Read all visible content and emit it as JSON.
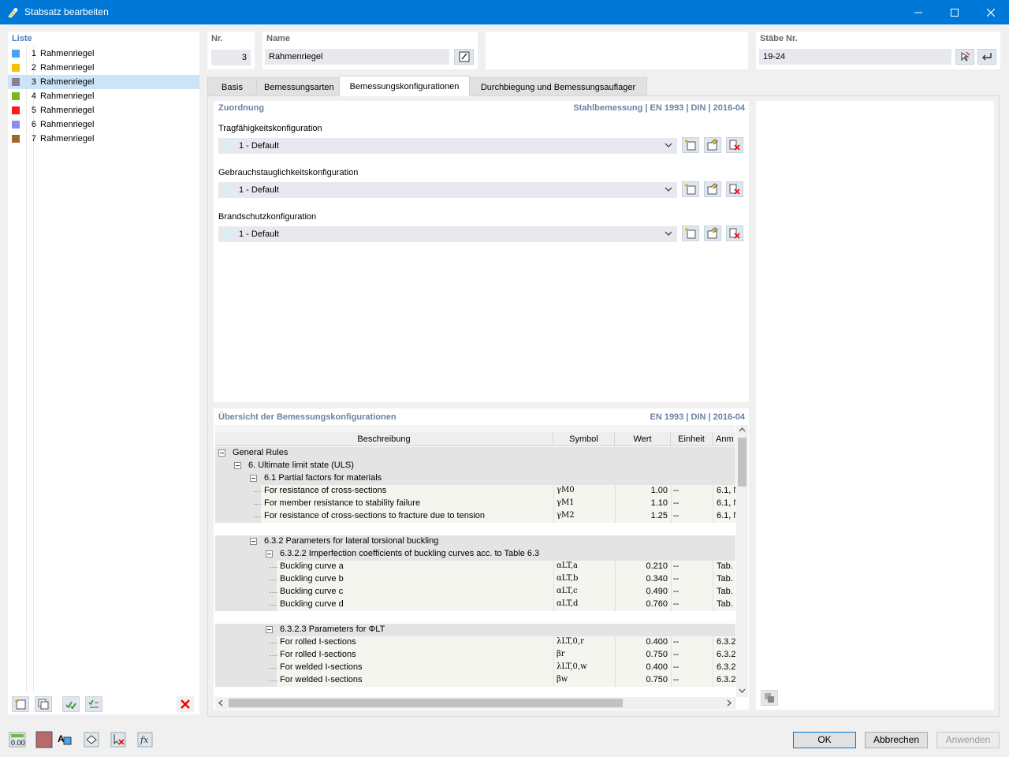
{
  "window": {
    "title": "Stabsatz bearbeiten"
  },
  "list": {
    "title": "Liste",
    "items": [
      {
        "num": "1",
        "label": "Rahmenriegel",
        "color": "#4aa3f0"
      },
      {
        "num": "2",
        "label": "Rahmenriegel",
        "color": "#f2c200"
      },
      {
        "num": "3",
        "label": "Rahmenriegel",
        "color": "#8a7d9a"
      },
      {
        "num": "4",
        "label": "Rahmenriegel",
        "color": "#7bb61c"
      },
      {
        "num": "5",
        "label": "Rahmenriegel",
        "color": "#ff1a1a"
      },
      {
        "num": "6",
        "label": "Rahmenriegel",
        "color": "#8c8cf0"
      },
      {
        "num": "7",
        "label": "Rahmenriegel",
        "color": "#9a6a2c"
      }
    ],
    "selected_index": 2
  },
  "header": {
    "nr_label": "Nr.",
    "nr_value": "3",
    "name_label": "Name",
    "name_value": "Rahmenriegel",
    "staebe_label": "Stäbe Nr.",
    "staebe_value": "19-24"
  },
  "tabs": [
    {
      "label": "Basis"
    },
    {
      "label": "Bemessungsarten"
    },
    {
      "label": "Bemessungskonfigurationen"
    },
    {
      "label": "Durchbiegung und Bemessungsauflager"
    }
  ],
  "active_tab": 2,
  "zuordnung": {
    "title": "Zuordnung",
    "meta": "Stahlbemessung | EN 1993 | DIN | 2016-04",
    "configs": [
      {
        "label": "Tragfähigkeitskonfiguration",
        "value": "1 - Default"
      },
      {
        "label": "Gebrauchstauglichkeitskonfiguration",
        "value": "1 - Default"
      },
      {
        "label": "Brandschutzkonfiguration",
        "value": "1 - Default"
      }
    ]
  },
  "overview": {
    "title": "Übersicht der Bemessungskonfigurationen",
    "meta": "EN 1993 | DIN | 2016-04",
    "columns": [
      "Beschreibung",
      "Symbol",
      "Wert",
      "Einheit",
      "Anm"
    ],
    "rows": [
      {
        "desc": "General Rules",
        "sym": "",
        "val": "",
        "unit": "",
        "anm": ""
      },
      {
        "desc": "6. Ultimate limit state (ULS)",
        "sym": "",
        "val": "",
        "unit": "",
        "anm": ""
      },
      {
        "desc": "6.1 Partial factors for materials",
        "sym": "",
        "val": "",
        "unit": "",
        "anm": ""
      },
      {
        "desc": "For resistance of cross-sections",
        "sym": "γM0",
        "val": "1.00",
        "unit": "--",
        "anm": "6.1, N"
      },
      {
        "desc": "For member resistance to stability failure",
        "sym": "γM1",
        "val": "1.10",
        "unit": "--",
        "anm": "6.1, N"
      },
      {
        "desc": "For resistance of cross-sections to fracture due to tension",
        "sym": "γM2",
        "val": "1.25",
        "unit": "--",
        "anm": "6.1, N"
      },
      {
        "desc": "",
        "sym": "",
        "val": "",
        "unit": "",
        "anm": ""
      },
      {
        "desc": "6.3.2 Parameters for lateral torsional buckling",
        "sym": "",
        "val": "",
        "unit": "",
        "anm": ""
      },
      {
        "desc": "6.3.2.2 Imperfection coefficients of buckling curves acc. to Table 6.3",
        "sym": "",
        "val": "",
        "unit": "",
        "anm": ""
      },
      {
        "desc": "Buckling curve a",
        "sym": "αLT,a",
        "val": "0.210",
        "unit": "--",
        "anm": "Tab."
      },
      {
        "desc": "Buckling curve b",
        "sym": "αLT,b",
        "val": "0.340",
        "unit": "--",
        "anm": "Tab."
      },
      {
        "desc": "Buckling curve c",
        "sym": "αLT,c",
        "val": "0.490",
        "unit": "--",
        "anm": "Tab."
      },
      {
        "desc": "Buckling curve d",
        "sym": "αLT,d",
        "val": "0.760",
        "unit": "--",
        "anm": "Tab."
      },
      {
        "desc": "",
        "sym": "",
        "val": "",
        "unit": "",
        "anm": ""
      },
      {
        "desc": "6.3.2.3 Parameters for ΦLT",
        "sym": "",
        "val": "",
        "unit": "",
        "anm": ""
      },
      {
        "desc": "For rolled I-sections",
        "sym": "λLT,0,r",
        "val": "0.400",
        "unit": "--",
        "anm": "6.3.2"
      },
      {
        "desc": "For rolled I-sections",
        "sym": "βr",
        "val": "0.750",
        "unit": "--",
        "anm": "6.3.2"
      },
      {
        "desc": "For welded I-sections",
        "sym": "λLT,0,w",
        "val": "0.400",
        "unit": "--",
        "anm": "6.3.2"
      },
      {
        "desc": "For welded I-sections",
        "sym": "βw",
        "val": "0.750",
        "unit": "--",
        "anm": "6.3.2"
      }
    ]
  },
  "footer": {
    "ok_label": "OK",
    "cancel_label": "Abbrechen",
    "apply_label": "Anwenden"
  }
}
